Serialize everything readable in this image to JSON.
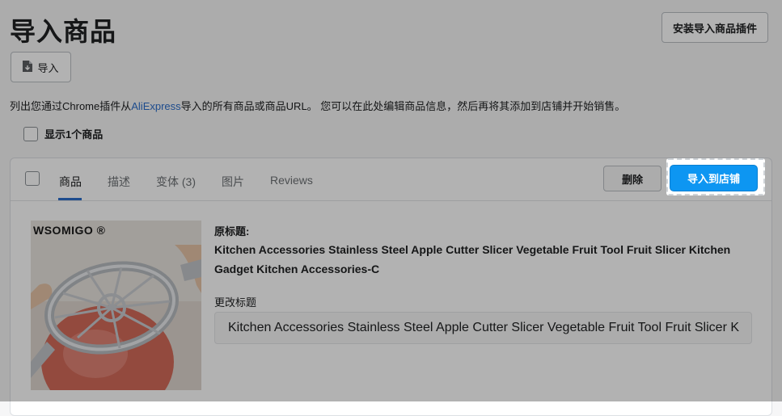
{
  "header": {
    "title": "导入商品",
    "install_label": "安装导入商品插件",
    "import_label": "导入"
  },
  "description": {
    "prefix": "列出您通过Chrome插件从",
    "link": "AliExpress",
    "suffix": "导入的所有商品或商品URL。 您可以在此处编辑商品信息，然后再将其添加到店铺并开始销售。"
  },
  "show_count_label": "显示1个商品",
  "card": {
    "tabs": [
      {
        "label": "商品",
        "active": true
      },
      {
        "label": "描述"
      },
      {
        "label": "变体 (3)"
      },
      {
        "label": "图片"
      },
      {
        "label": "Reviews"
      }
    ],
    "delete_label": "删除",
    "push_label": "导入到店铺"
  },
  "product": {
    "image_brand": "WSOMIGO ®",
    "original_title_label": "原标题:",
    "original_title": "Kitchen Accessories Stainless Steel Apple Cutter Slicer Vegetable Fruit Tool Fruit Slicer Kitchen Gadget Kitchen Accessories-C",
    "edit_title_label": "更改标题",
    "edit_title_value": "Kitchen Accessories Stainless Steel Apple Cutter Slicer Vegetable Fruit Tool Fruit Slicer K"
  },
  "colors": {
    "accent": "#0d96f2",
    "link": "#2c6ecb",
    "overlay": "rgba(0,0,0,0.30)"
  }
}
